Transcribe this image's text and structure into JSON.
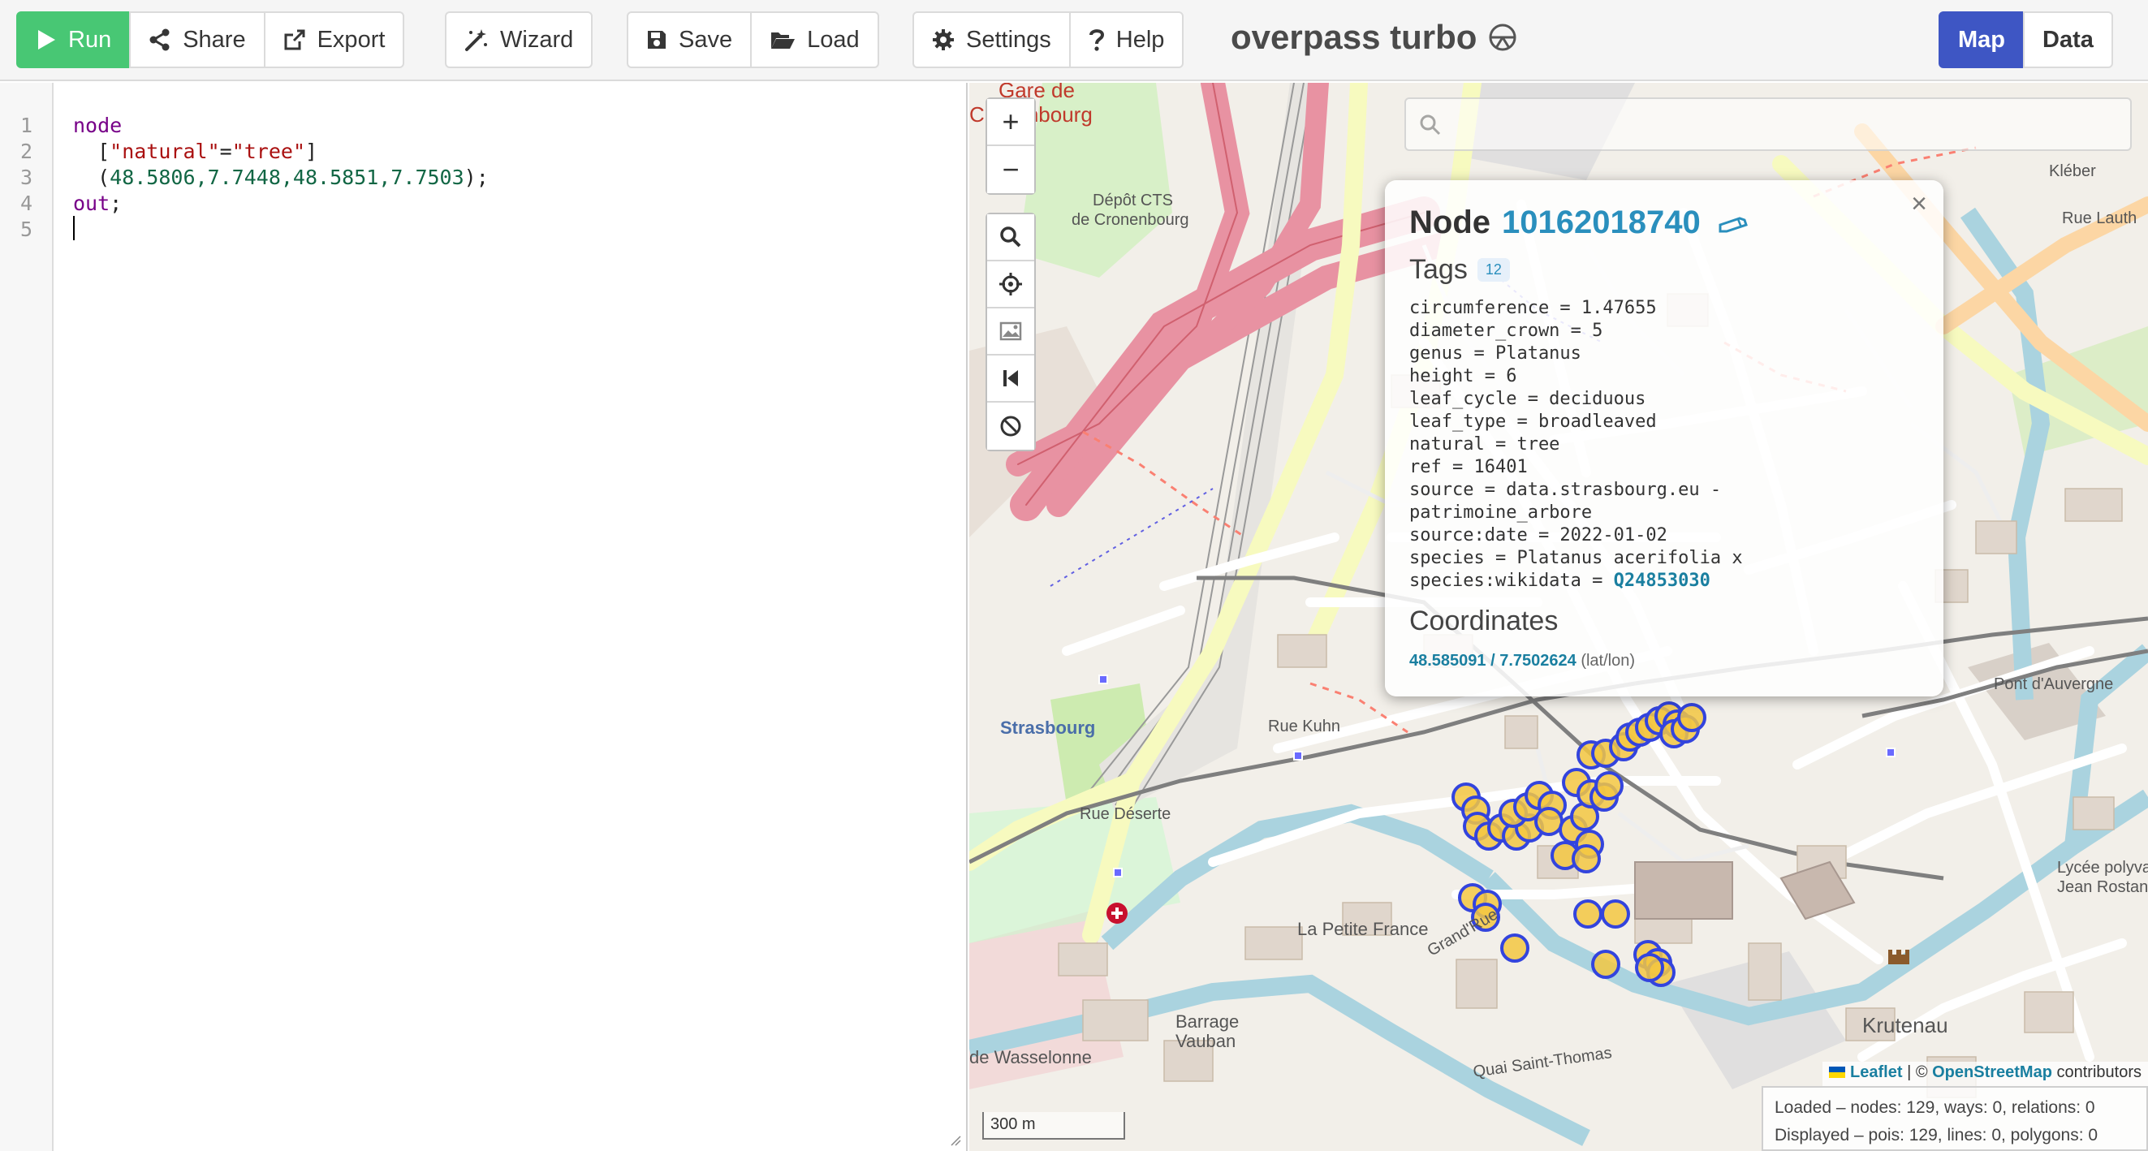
{
  "toolbar": {
    "run_label": "Run",
    "share_label": "Share",
    "export_label": "Export",
    "wizard_label": "Wizard",
    "save_label": "Save",
    "load_label": "Load",
    "settings_label": "Settings",
    "help_label": "Help",
    "map_tab_label": "Map",
    "data_tab_label": "Data"
  },
  "app": {
    "title": "overpass turbo"
  },
  "editor": {
    "line_numbers": [
      "1",
      "2",
      "3",
      "4",
      "5"
    ],
    "line1_kw": "node",
    "line2_open": "  [",
    "line2_key": "\"natural\"",
    "line2_eq": "=",
    "line2_val": "\"tree\"",
    "line2_close": "]",
    "line3_open": "  (",
    "line3_nums": "48.5806,7.7448,48.5851,7.7503",
    "line3_close": ");",
    "line4_kw": "out",
    "line4_end": ";"
  },
  "map": {
    "search_placeholder": "",
    "labels": {
      "gare": "Gare de",
      "cronenbourg": "Cronenbourg",
      "depot": "Dépôt CTS",
      "depot2": "de Cronenbourg",
      "kleber": "Kléber",
      "rue_lauth": "Rue Lauth",
      "strasbourg": "Strasbourg",
      "rue_deserte": "Rue Déserte",
      "petite_france": "La Petite France",
      "barrage": "Barrage",
      "vauban": "Vauban",
      "wasselonne": "de Wasselonne",
      "krutenau": "Krutenau",
      "pont_auvergne": "Pont d'Auvergne",
      "lycee": "Lycée polyvale",
      "jean_rostand": "Jean Rostand",
      "quai_st_thomas": "Quai Saint-Thomas",
      "grand_rue": "Grand'Rue",
      "rue_kuhn": "Rue Kuhn"
    },
    "zoom_in": "+",
    "zoom_out": "−",
    "popup": {
      "heading_prefix": "Node",
      "node_id": "10162018740",
      "tags_heading": "Tags",
      "tags_count": "12",
      "tags": [
        "circumference = 1.47655",
        "diameter_crown = 5",
        "genus = Platanus",
        "height = 6",
        "leaf_cycle = deciduous",
        "leaf_type = broadleaved",
        "natural = tree",
        "ref = 16401",
        "source = data.strasbourg.eu -",
        "patrimoine_arbore",
        "source:date = 2022-01-02",
        "species = Platanus acerifolia x"
      ],
      "wikidata_key": "species:wikidata = ",
      "wikidata_value": "Q24853030",
      "coords_heading": "Coordinates",
      "coords_value": "48.585091 / 7.7502624",
      "coords_unit": "(lat/lon)",
      "close": "×"
    },
    "attribution": {
      "leaflet": "Leaflet",
      "sep": " | © ",
      "osm": "OpenStreetMap",
      "contributors": " contributors"
    },
    "scale": "300 m",
    "stats": {
      "loaded": "Loaded – nodes: 129, ways: 0, relations: 0",
      "displayed": "Displayed – pois: 129, lines: 0, polygons: 0"
    }
  },
  "colors": {
    "run_green": "#48c774",
    "map_tab_blue": "#3e56c4",
    "marker_fill": "#f3c742",
    "marker_stroke": "#3344dd",
    "link_blue": "#2a8fbd"
  }
}
